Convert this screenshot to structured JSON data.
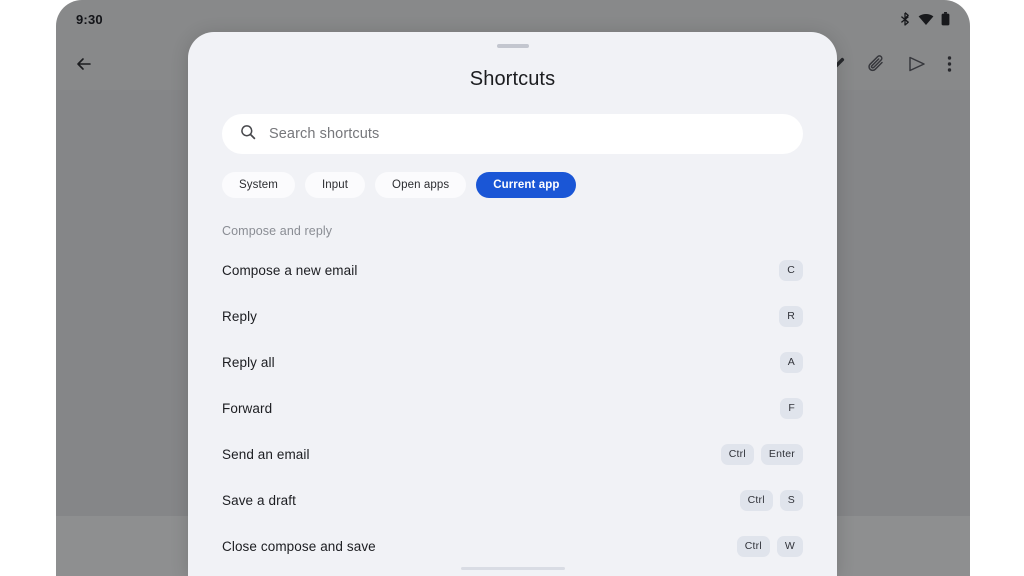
{
  "status_bar": {
    "clock": "9:30",
    "icons": [
      "bluetooth-icon",
      "wifi-icon",
      "battery-icon"
    ]
  },
  "app_bar": {
    "back_icon": "back-arrow-icon",
    "actions": [
      "pencil-icon",
      "attachment-icon",
      "send-icon",
      "overflow-menu-icon"
    ]
  },
  "dialog": {
    "title": "Shortcuts",
    "drag_handle": "drag-handle",
    "search": {
      "placeholder": "Search shortcuts",
      "value": "",
      "icon": "search-icon"
    },
    "chips": [
      {
        "label": "System",
        "selected": false
      },
      {
        "label": "Input",
        "selected": false
      },
      {
        "label": "Open apps",
        "selected": false
      },
      {
        "label": "Current app",
        "selected": true
      }
    ],
    "sections": [
      {
        "header": "Compose and reply",
        "rows": [
          {
            "label": "Compose a new email",
            "keys": [
              "C"
            ]
          },
          {
            "label": "Reply",
            "keys": [
              "R"
            ]
          },
          {
            "label": "Reply all",
            "keys": [
              "A"
            ]
          },
          {
            "label": "Forward",
            "keys": [
              "F"
            ]
          },
          {
            "label": "Send an email",
            "keys": [
              "Ctrl",
              "Enter"
            ]
          },
          {
            "label": "Save a draft",
            "keys": [
              "Ctrl",
              "S"
            ]
          },
          {
            "label": "Close compose and save",
            "keys": [
              "Ctrl",
              "W"
            ]
          }
        ]
      }
    ]
  },
  "colors": {
    "accent": "#1a56d6",
    "dialog_bg": "#f1f2f6",
    "key_bg": "#e0e4ec",
    "scrim": "#919293"
  }
}
